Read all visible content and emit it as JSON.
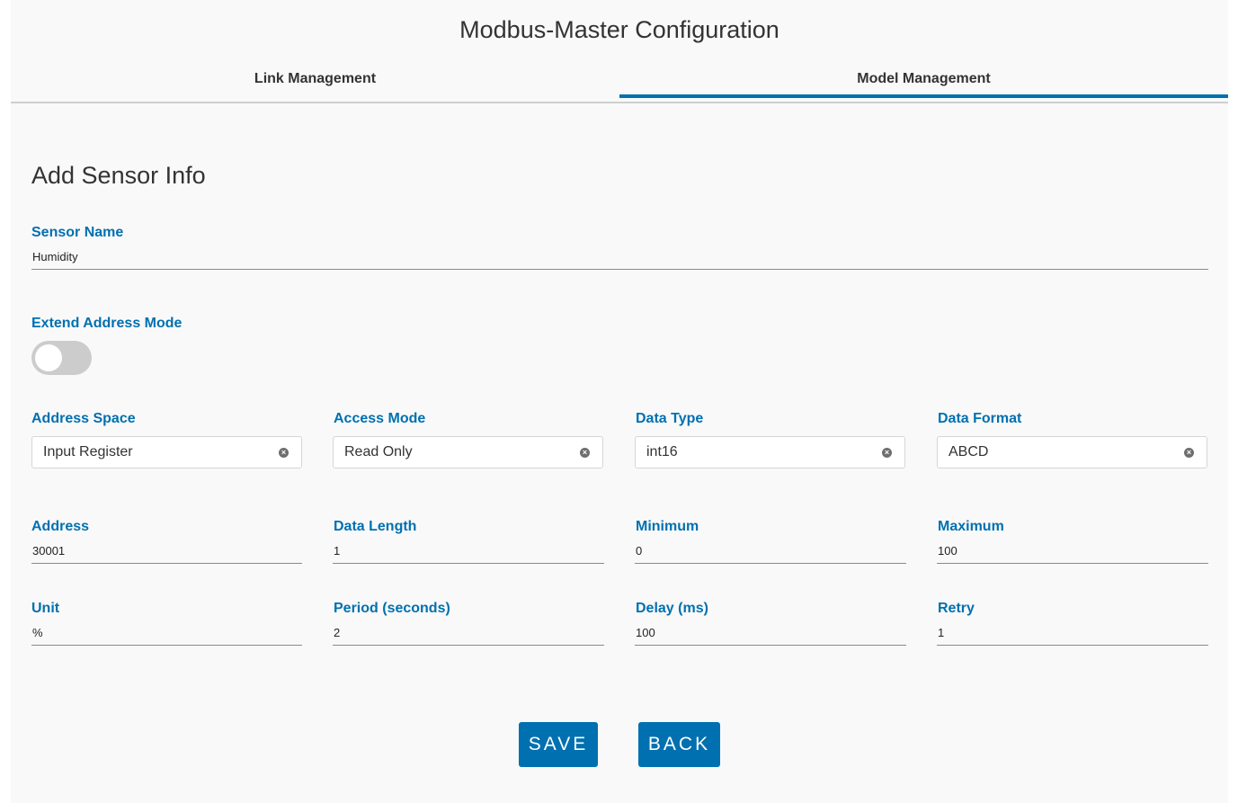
{
  "app": {
    "title": "Modbus-Master Configuration"
  },
  "tabs": [
    {
      "label": "Link Management",
      "active": false
    },
    {
      "label": "Model Management",
      "active": true
    }
  ],
  "form": {
    "title": "Add Sensor Info",
    "sensor_name": {
      "label": "Sensor Name",
      "value": "Humidity"
    },
    "extend_address_mode": {
      "label": "Extend Address Mode",
      "enabled": false
    },
    "selects": [
      {
        "label": "Address Space",
        "value": "Input Register"
      },
      {
        "label": "Access Mode",
        "value": "Read Only"
      },
      {
        "label": "Data Type",
        "value": "int16"
      },
      {
        "label": "Data Format",
        "value": "ABCD"
      }
    ],
    "row1": [
      {
        "label": "Address",
        "value": "30001"
      },
      {
        "label": "Data Length",
        "value": "1"
      },
      {
        "label": "Minimum",
        "value": "0"
      },
      {
        "label": "Maximum",
        "value": "100"
      }
    ],
    "row2": [
      {
        "label": "Unit",
        "value": "%"
      },
      {
        "label": "Period (seconds)",
        "value": "2"
      },
      {
        "label": "Delay (ms)",
        "value": "100"
      },
      {
        "label": "Retry",
        "value": "1"
      }
    ]
  },
  "buttons": {
    "save": "SAVE",
    "back": "BACK"
  },
  "icons": {
    "clear": "clear-circle-icon"
  },
  "colors": {
    "accent": "#0070b0",
    "panel": "#f9f9f9",
    "toggle_off": "#cccccc"
  }
}
